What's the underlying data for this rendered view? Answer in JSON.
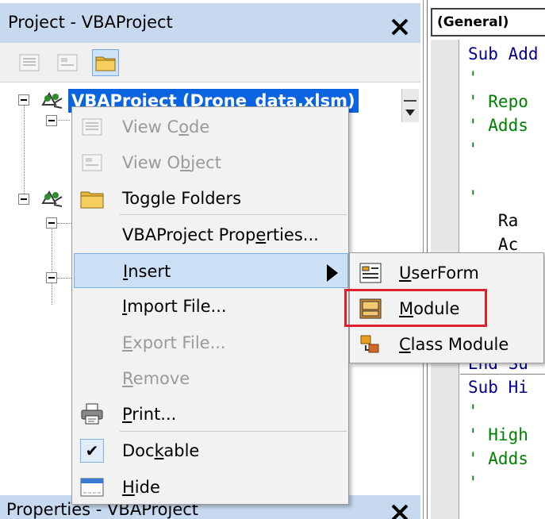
{
  "project_pane": {
    "title": "Project - VBAProject",
    "tree": {
      "root_label": "VBAProject (Drone_data.xlsm)"
    }
  },
  "properties_pane": {
    "title": "Properties - VBAProject"
  },
  "code_window": {
    "object_dropdown": "(General)",
    "lines": [
      {
        "text": "Sub Add",
        "kind": "kw"
      },
      {
        "text": "'",
        "kind": "cm"
      },
      {
        "text": "' Repo",
        "kind": "cm"
      },
      {
        "text": "' Adds",
        "kind": "cm"
      },
      {
        "text": "'",
        "kind": "cm"
      },
      {
        "text": "",
        "kind": "tx"
      },
      {
        "text": "'",
        "kind": "cm"
      },
      {
        "text": "   Ra",
        "kind": "tx"
      },
      {
        "text": "   Ac",
        "kind": "tx"
      },
      {
        "text": "",
        "kind": "tx"
      },
      {
        "text": "",
        "kind": "tx"
      },
      {
        "text": "",
        "kind": "tx"
      },
      {
        "text": "",
        "kind": "tx"
      },
      {
        "text": "End Su",
        "kind": "kw"
      },
      {
        "text": "Sub Hi",
        "kind": "kw"
      },
      {
        "text": "'",
        "kind": "cm"
      },
      {
        "text": "' High",
        "kind": "cm"
      },
      {
        "text": "' Adds",
        "kind": "cm"
      },
      {
        "text": "'",
        "kind": "cm"
      }
    ]
  },
  "context_menu": {
    "items": [
      {
        "pre": "View C",
        "key": "o",
        "post": "de",
        "icon": "view-code-icon",
        "enabled": false
      },
      {
        "pre": "View O",
        "key": "b",
        "post": "ject",
        "icon": "view-object-icon",
        "enabled": false
      },
      {
        "pre": "",
        "key": "",
        "post": "Toggle Folders",
        "icon": "folder-icon",
        "enabled": true
      },
      {
        "pre": "VBAProject Prop",
        "key": "e",
        "post": "rties...",
        "icon": "",
        "enabled": true
      },
      {
        "pre": "",
        "key": "I",
        "post": "nsert",
        "icon": "",
        "enabled": true,
        "highlighted": true,
        "submenu": true
      },
      {
        "pre": "",
        "key": "I",
        "post": "mport File...",
        "icon": "",
        "enabled": true
      },
      {
        "pre": "",
        "key": "E",
        "post": "xport File...",
        "icon": "",
        "enabled": false
      },
      {
        "pre": "",
        "key": "R",
        "post": "emove",
        "icon": "",
        "enabled": false
      },
      {
        "pre": "",
        "key": "P",
        "post": "rint...",
        "icon": "printer-icon",
        "enabled": true
      },
      {
        "pre": "Doc",
        "key": "k",
        "post": "able",
        "icon": "checkmark-icon",
        "enabled": true,
        "checked": true
      },
      {
        "pre": "",
        "key": "H",
        "post": "ide",
        "icon": "window-icon",
        "enabled": true
      }
    ]
  },
  "insert_submenu": {
    "items": [
      {
        "pre": "",
        "key": "U",
        "post": "serForm",
        "icon": "userform-icon"
      },
      {
        "pre": "",
        "key": "M",
        "post": "odule",
        "icon": "module-icon",
        "callout": true
      },
      {
        "pre": "",
        "key": "C",
        "post": "lass Module",
        "icon": "class-module-icon"
      }
    ]
  },
  "colors": {
    "selection": "#0a64e0",
    "titlebar": "#c7d9ef",
    "callout": "#e0202c",
    "menu_highlight": "#cce0f5"
  }
}
